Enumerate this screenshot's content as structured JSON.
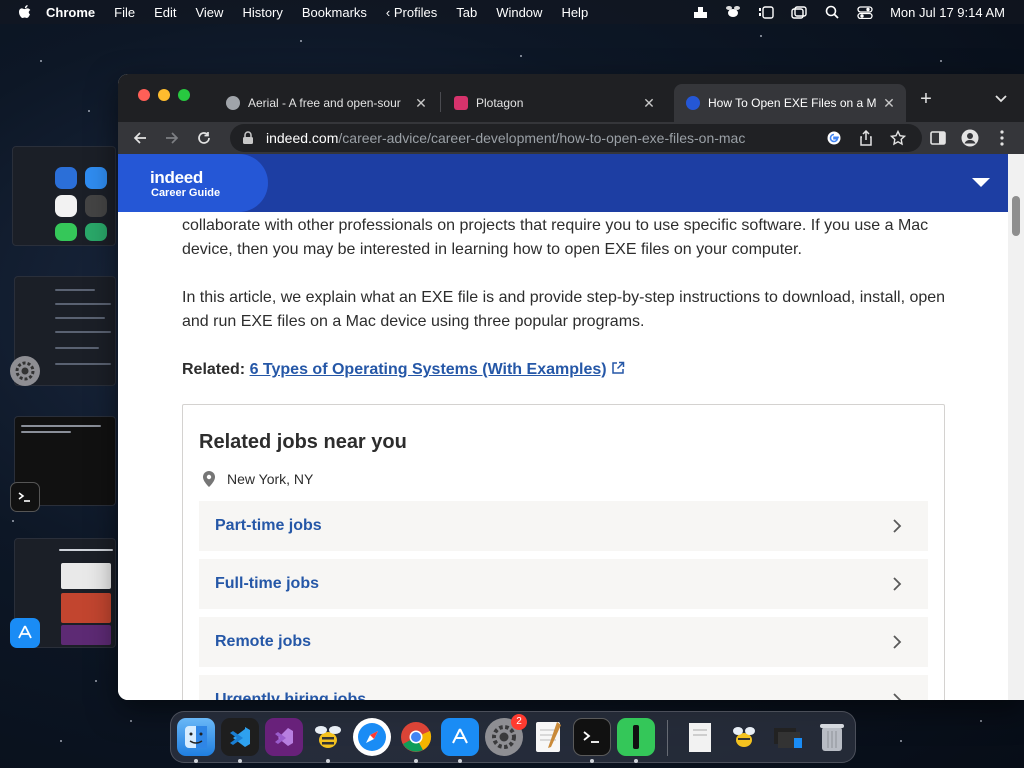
{
  "menubar": {
    "app_name": "Chrome",
    "items": [
      "File",
      "Edit",
      "View",
      "History",
      "Bookmarks",
      "‹ Profiles",
      "Tab",
      "Window",
      "Help"
    ],
    "clock": "Mon Jul 17  9:14 AM",
    "status_icons": [
      "dropbox-icon",
      "bee-icon",
      "stage-manager-icon",
      "screen-mirror-icon",
      "search-icon",
      "control-center-icon"
    ]
  },
  "tabs": [
    {
      "title": "Aerial - A free and open-sour",
      "icon": "aerial-favicon",
      "active": false
    },
    {
      "title": "Plotagon",
      "icon": "plotagon-favicon",
      "active": false
    },
    {
      "title": "How To Open EXE Files on a M",
      "icon": "indeed-favicon",
      "active": true
    }
  ],
  "omnibox": {
    "host": "indeed.com",
    "path": "/career-advice/career-development/how-to-open-exe-files-on-mac"
  },
  "site_header": {
    "logo_word": "indeed",
    "logo_sub": "Career Guide"
  },
  "article": {
    "para1": "collaborate with other professionals on projects that require you to use specific software. If you use a Mac device, then you may be interested in learning how to open EXE files on your computer.",
    "para2": "In this article, we explain what an EXE file is and provide step-by-step instructions to download, install, open and run EXE files on a Mac device using three popular programs.",
    "related_label": "Related:",
    "related_link": "6 Types of Operating Systems (With Examples)"
  },
  "jobs_card": {
    "title": "Related jobs near you",
    "location": "New York, NY",
    "rows": [
      "Part-time jobs",
      "Full-time jobs",
      "Remote jobs",
      "Urgently hiring jobs"
    ]
  },
  "dock": {
    "badge_count": "2"
  },
  "colors": {
    "indeed_blue": "#2557a7",
    "header_navy": "#1d3ea3",
    "chrome_dark": "#1f2023",
    "chrome_toolbar": "#35363a"
  }
}
